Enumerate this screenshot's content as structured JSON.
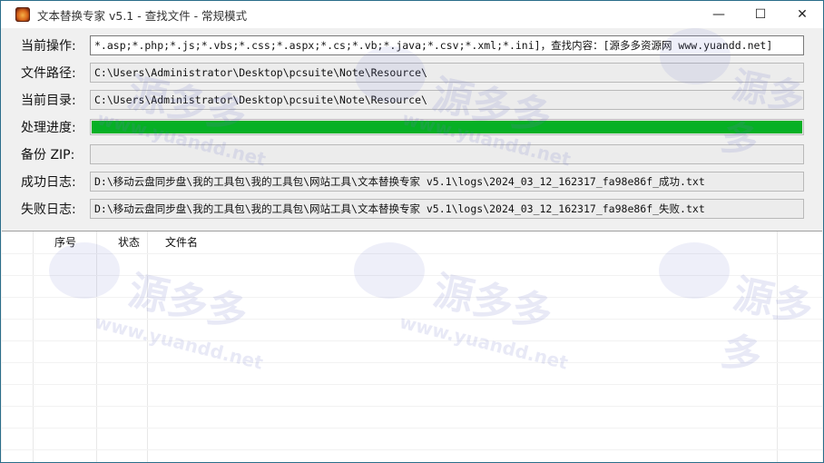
{
  "window": {
    "title": "文本替换专家 v5.1  -  查找文件 - 常规模式",
    "minimize_glyph": "—",
    "maximize_glyph": "☐",
    "close_glyph": "✕"
  },
  "form": {
    "operation": {
      "label": "当前操作:",
      "value": "*.asp;*.php;*.js;*.vbs;*.css;*.aspx;*.cs;*.vb;*.java;*.csv;*.xml;*.ini]，查找内容：[源多多资源网  www.yuandd.net]"
    },
    "file_path": {
      "label": "文件路径:",
      "value": "C:\\Users\\Administrator\\Desktop\\pcsuite\\Note\\Resource\\"
    },
    "current_dir": {
      "label": "当前目录:",
      "value": "C:\\Users\\Administrator\\Desktop\\pcsuite\\Note\\Resource\\"
    },
    "progress": {
      "label": "处理进度:",
      "percent": 100,
      "color": "#06b025"
    },
    "backup_zip": {
      "label": "备份 ZIP:",
      "value": ""
    },
    "success_log": {
      "label": "成功日志:",
      "value": "D:\\移动云盘同步盘\\我的工具包\\我的工具包\\网站工具\\文本替换专家 v5.1\\logs\\2024_03_12_162317_fa98e86f_成功.txt"
    },
    "fail_log": {
      "label": "失败日志:",
      "value": "D:\\移动云盘同步盘\\我的工具包\\我的工具包\\网站工具\\文本替换专家 v5.1\\logs\\2024_03_12_162317_fa98e86f_失败.txt"
    }
  },
  "list": {
    "columns": [
      "序号",
      "状态",
      "文件名"
    ],
    "rows": []
  },
  "watermark": {
    "brand": "源多多",
    "site": "www.yuandd.net",
    "tag": "YuanDD.Net"
  }
}
